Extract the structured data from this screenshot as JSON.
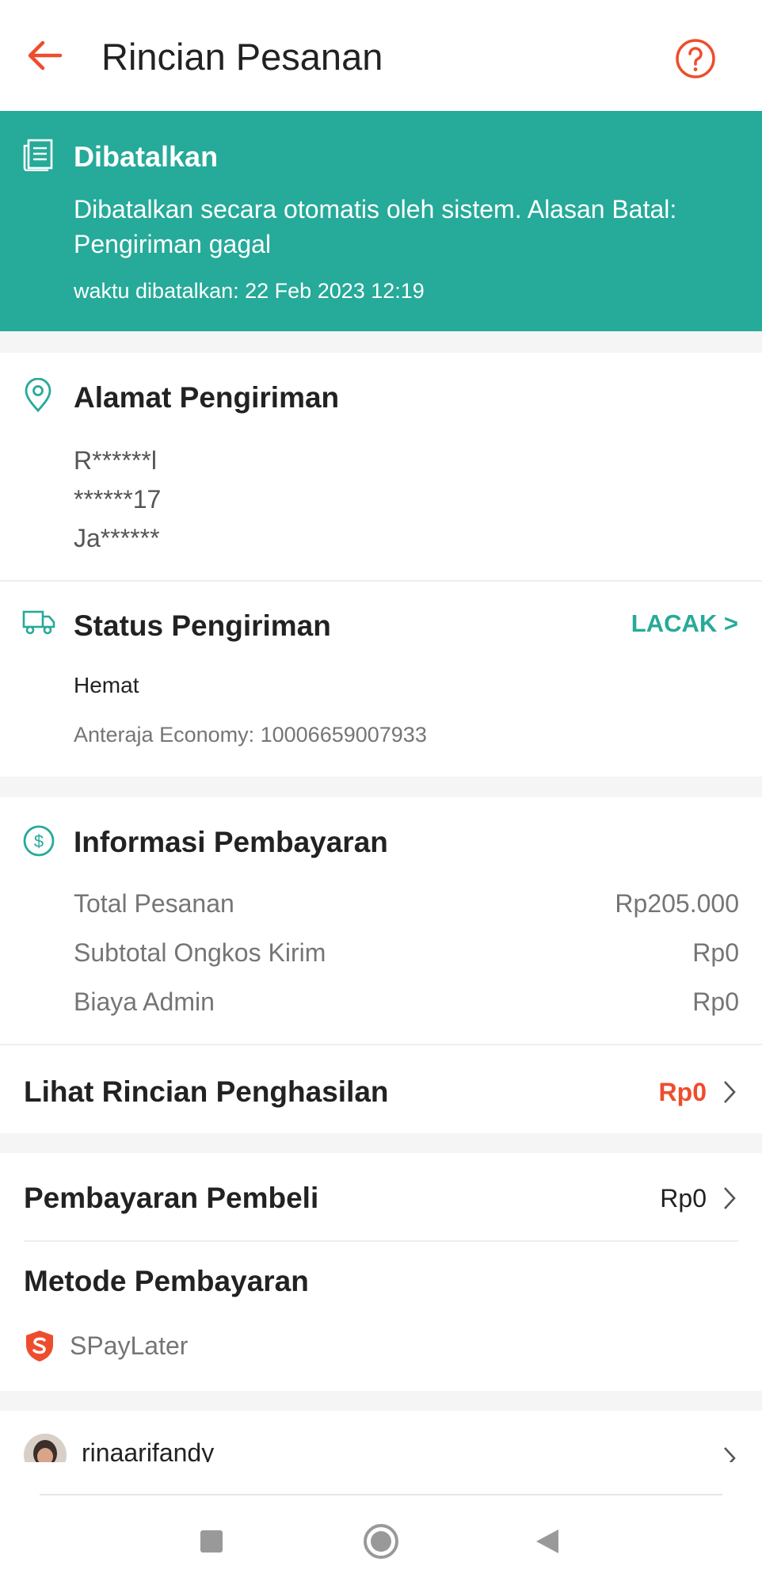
{
  "header": {
    "title": "Rincian Pesanan"
  },
  "status_banner": {
    "status": "Dibatalkan",
    "reason": "Dibatalkan secara otomatis oleh sistem. Alasan Batal: Pengiriman gagal",
    "time": "waktu dibatalkan: 22 Feb 2023 12:19"
  },
  "address": {
    "title": "Alamat Pengiriman",
    "lines": [
      "R******l",
      "******17",
      "Ja******"
    ]
  },
  "shipping": {
    "title": "Status Pengiriman",
    "track_label": "LACAK >",
    "service": "Hemat",
    "tracking": "Anteraja Economy: 10006659007933"
  },
  "payment_info": {
    "title": "Informasi Pembayaran",
    "rows": [
      {
        "label": "Total Pesanan",
        "value": "Rp205.000"
      },
      {
        "label": "Subtotal Ongkos Kirim",
        "value": "Rp0"
      },
      {
        "label": "Biaya Admin",
        "value": "Rp0"
      }
    ]
  },
  "income": {
    "label": "Lihat Rincian Penghasilan",
    "value": "Rp0"
  },
  "buyer_payment": {
    "label": "Pembayaran Pembeli",
    "value": "Rp0"
  },
  "payment_method": {
    "title": "Metode Pembayaran",
    "method": "SPayLater"
  },
  "buyer": {
    "username": "rinaarifandy"
  },
  "colors": {
    "teal": "#26aa99",
    "orange": "#ee4d2d"
  }
}
